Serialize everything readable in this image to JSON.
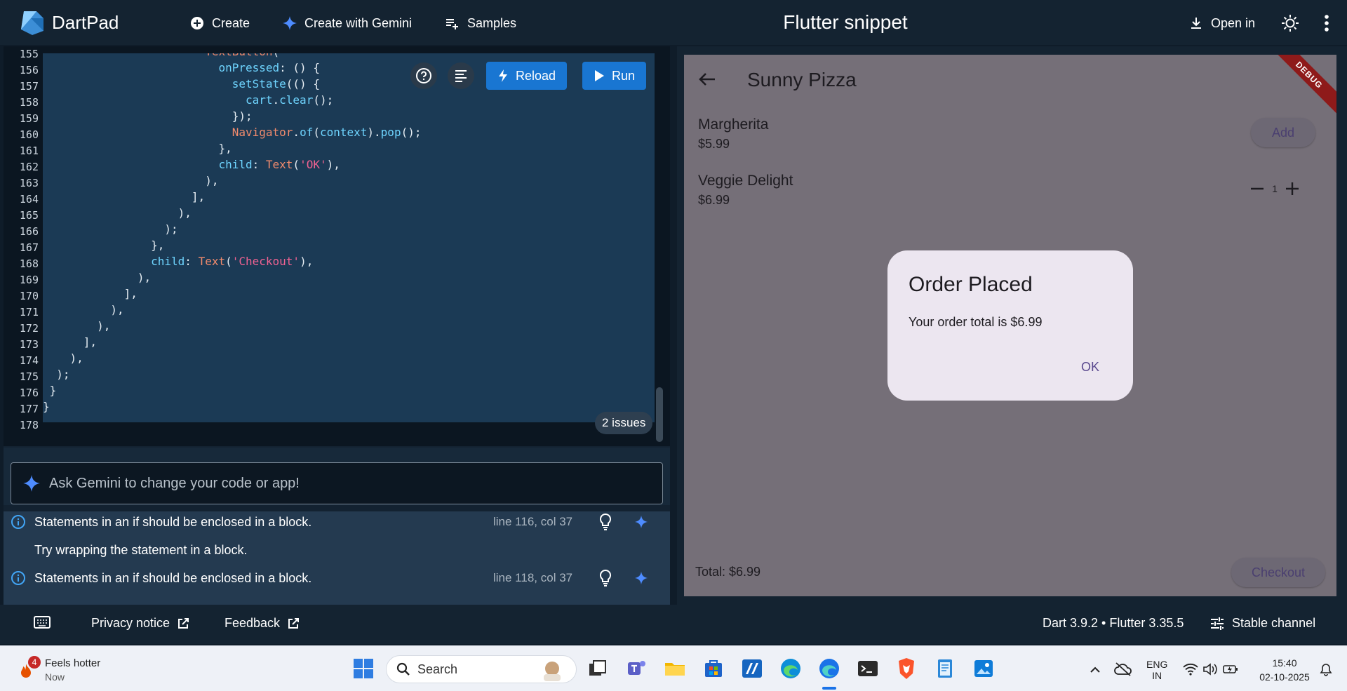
{
  "header": {
    "brand": "DartPad",
    "create_label": "Create",
    "create_gemini_label": "Create with Gemini",
    "samples_label": "Samples",
    "title": "Flutter snippet",
    "open_in_label": "Open in"
  },
  "editor": {
    "line_numbers": [
      "155",
      "156",
      "157",
      "158",
      "159",
      "160",
      "161",
      "162",
      "163",
      "164",
      "165",
      "166",
      "167",
      "168",
      "169",
      "170",
      "171",
      "172",
      "173",
      "174",
      "175",
      "176",
      "177",
      "178"
    ],
    "reload_label": "Reload",
    "run_label": "Run",
    "issues_label": "2 issues"
  },
  "gemini": {
    "placeholder": "Ask Gemini to change your code or app!"
  },
  "problems": [
    {
      "message": "Statements in an if should be enclosed in a block.",
      "location": "line 116, col 37"
    },
    {
      "message": "Try wrapping the statement in a block.",
      "location": ""
    },
    {
      "message": "Statements in an if should be enclosed in a block.",
      "location": "line 118, col 37"
    }
  ],
  "preview": {
    "app_title": "Sunny Pizza",
    "debug_label": "DEBUG",
    "items": [
      {
        "name": "Margherita",
        "price": "$5.99",
        "action": "Add"
      },
      {
        "name": "Veggie Delight",
        "price": "$6.99",
        "quantity": "1"
      }
    ],
    "total": "Total: $6.99",
    "checkout_label": "Checkout",
    "dialog": {
      "title": "Order Placed",
      "body": "Your order total is $6.99",
      "ok_label": "OK"
    }
  },
  "footer": {
    "privacy_label": "Privacy notice",
    "feedback_label": "Feedback",
    "version": "Dart 3.9.2 • Flutter 3.35.5",
    "channel_label": "Stable channel"
  },
  "taskbar": {
    "weather_badge": "4",
    "weather_text": "Feels hotter",
    "weather_sub": "Now",
    "search_label": "Search",
    "lang_top": "ENG",
    "lang_bottom": "IN",
    "time": "15:40",
    "date": "02-10-2025"
  },
  "colors": {
    "accent_blue": "#1976d2",
    "editor_selection": "#1b3a55",
    "dialog_bg": "#ece6f0"
  }
}
